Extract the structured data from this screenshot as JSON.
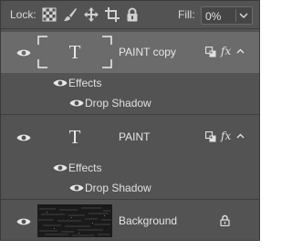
{
  "toolbar": {
    "lock_label": "Lock:",
    "lock_icons": [
      "lock-transparent-pixels-icon",
      "lock-image-pixels-icon",
      "lock-position-icon",
      "artboard-lock-icon",
      "lock-all-icon"
    ],
    "fill_label": "Fill:",
    "fill_value": "0%"
  },
  "layers": [
    {
      "name": "PAINT copy",
      "type": "text",
      "thumb_glyph": "T",
      "selected": true,
      "visible": true,
      "has_effects": true,
      "effects_label": "Effects",
      "effects": [
        "Drop Shadow"
      ]
    },
    {
      "name": "PAINT",
      "type": "text",
      "thumb_glyph": "T",
      "selected": false,
      "visible": true,
      "has_effects": true,
      "effects_label": "Effects",
      "effects": [
        "Drop Shadow"
      ]
    },
    {
      "name": "Background",
      "type": "image",
      "selected": false,
      "visible": true,
      "locked": true
    }
  ],
  "icons": {
    "visibility": "eye-icon",
    "link": "link-icon",
    "fx": "fx",
    "collapse": "chevron-up-icon",
    "lock": "lock-icon"
  },
  "colors": {
    "panel_bg": "#535353",
    "selected_row": "#6b6b6b",
    "text": "#e6e6e6"
  }
}
